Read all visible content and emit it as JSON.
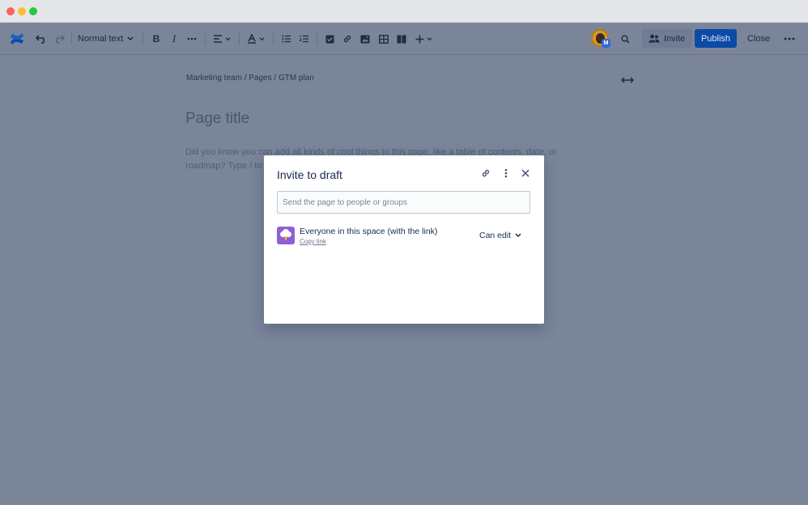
{
  "toolbar": {
    "text_style": "Normal text",
    "invite_label": "Invite",
    "publish_label": "Publish",
    "close_label": "Close",
    "avatar_badge": "M"
  },
  "editor": {
    "breadcrumb": "Marketing team / Pages / GTM plan",
    "title_placeholder": "Page title",
    "body_placeholder": "Did you know you can add all kinds of cool things to this page, like a table of contents, date, or roadmap? Type / to"
  },
  "modal": {
    "title": "Invite to draft",
    "search_placeholder": "Send the page to people or groups",
    "space_label": "Everyone in this space (with the link)",
    "copy_link_label": "Copy link",
    "permission": "Can edit"
  },
  "colors": {
    "publish": "#0b4aa7",
    "overlay": "#7a8599",
    "space_avatar": "#8f5fd6"
  }
}
